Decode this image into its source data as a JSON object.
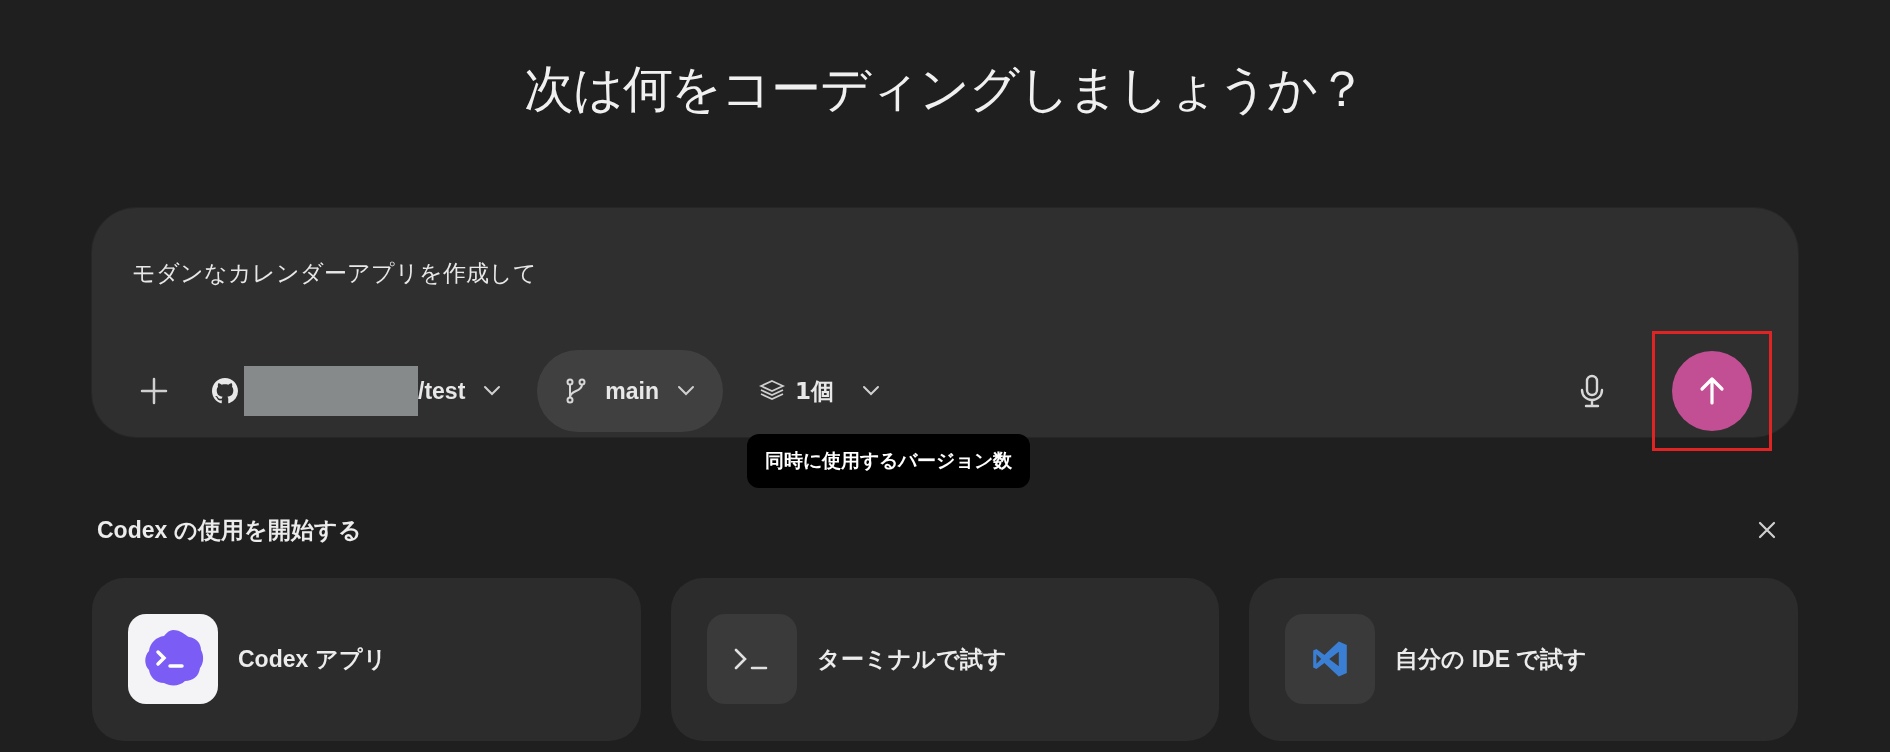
{
  "heading": "次は何をコーディングしましょうか？",
  "composer": {
    "value": "モダンなカレンダーアプリを作成して",
    "repo": {
      "suffix": "/test",
      "redacted": true
    },
    "branch": {
      "label": "main",
      "hovered": true
    },
    "versions": {
      "label": "1個"
    },
    "send": {
      "highlighted": true
    }
  },
  "tooltip": "同時に使用するバージョン数",
  "getting_started": {
    "title": "Codex の使用を開始する",
    "cards": [
      {
        "kind": "app",
        "label": "Codex アプリ"
      },
      {
        "kind": "terminal",
        "label": "ターミナルで試す"
      },
      {
        "kind": "ide",
        "label": "自分の IDE で試す"
      }
    ]
  }
}
